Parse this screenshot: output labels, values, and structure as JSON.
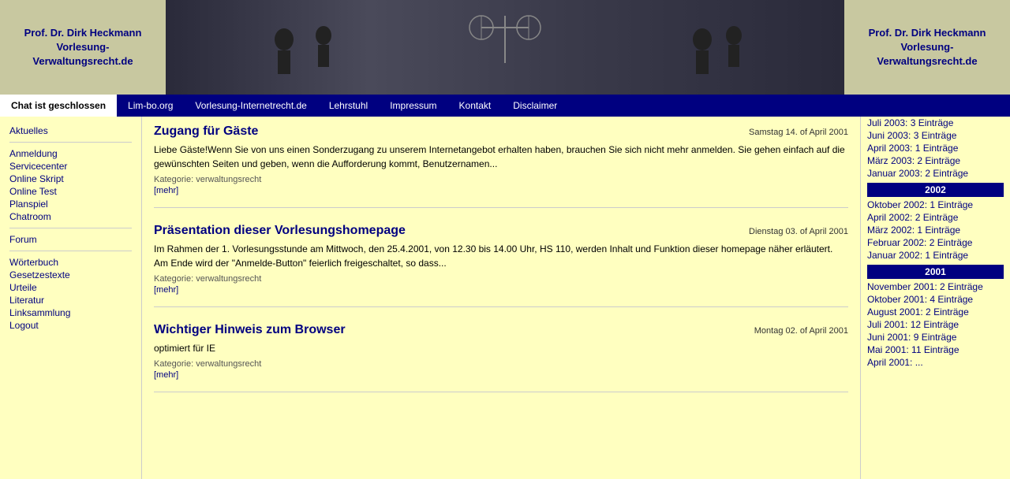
{
  "header": {
    "left_title": "Prof. Dr. Dirk Heckmann\nVorlesung-\nVerwaltungsrecht.de",
    "right_title": "Prof. Dr. Dirk Heckmann\nVorlesung-\nVerwaltungsrecht.de"
  },
  "navbar": {
    "items": [
      {
        "label": "Chat ist geschlossen",
        "active": true
      },
      {
        "label": "Lim-bo.org",
        "active": false
      },
      {
        "label": "Vorlesung-Internetrecht.de",
        "active": false
      },
      {
        "label": "Lehrstuhl",
        "active": false
      },
      {
        "label": "Impressum",
        "active": false
      },
      {
        "label": "Kontakt",
        "active": false
      },
      {
        "label": "Disclaimer",
        "active": false
      }
    ]
  },
  "sidebar": {
    "sections": [
      {
        "title": "Aktuelles",
        "links": []
      },
      {
        "title": "",
        "links": [
          "Anmeldung",
          "Servicecenter",
          "Online Skript",
          "Online Test",
          "Planspiel",
          "Chatroom"
        ]
      },
      {
        "title": "Forum",
        "links": []
      },
      {
        "title": "",
        "links": [
          "Wörterbuch",
          "Gesetzestexte",
          "Urteile",
          "Literatur",
          "Linksammlung",
          "Logout"
        ]
      }
    ]
  },
  "articles": [
    {
      "title": "Zugang für Gäste",
      "date": "Samstag 14. of April 2001",
      "body": "Liebe Gäste!Wenn Sie von uns einen Sonderzugang zu unserem Internetangebot erhalten haben, brauchen Sie sich nicht mehr anmelden. Sie gehen einfach auf die gewünschten Seiten und geben, wenn die Aufforderung kommt, Benutzernamen...",
      "category": "Kategorie: verwaltungsrecht",
      "more": "[mehr]"
    },
    {
      "title": "Präsentation dieser Vorlesungshomepage",
      "date": "Dienstag 03. of April 2001",
      "body": "Im Rahmen der 1. Vorlesungsstunde am Mittwoch, den 25.4.2001, von 12.30 bis 14.00 Uhr, HS 110, werden Inhalt und Funktion dieser homepage näher erläutert. Am Ende wird der \"Anmelde-Button\" feierlich freigeschaltet, so dass...",
      "category": "Kategorie: verwaltungsrecht",
      "more": "[mehr]"
    },
    {
      "title": "Wichtiger Hinweis zum Browser",
      "date": "Montag 02. of April 2001",
      "body": "optimiert für IE",
      "category": "Kategorie: verwaltungsrecht",
      "more": "[mehr]"
    }
  ],
  "right_sidebar": {
    "sections": [
      {
        "year": "",
        "entries": [
          "Juli 2003: 3 Einträge",
          "Juni 2003: 3 Einträge",
          "April 2003: 1 Einträge",
          "März 2003: 2 Einträge",
          "Januar 2003: 2 Einträge"
        ]
      },
      {
        "year": "2002",
        "entries": [
          "Oktober 2002: 1 Einträge",
          "April 2002: 2 Einträge",
          "März 2002: 1 Einträge",
          "Februar 2002: 2 Einträge",
          "Januar 2002: 1 Einträge"
        ]
      },
      {
        "year": "2001",
        "entries": [
          "November 2001: 2 Einträge",
          "Oktober 2001: 4 Einträge",
          "August 2001: 2 Einträge",
          "Juli 2001: 12 Einträge",
          "Juni 2001: 9 Einträge",
          "Mai 2001: 11 Einträge",
          "April 2001: ..."
        ]
      }
    ]
  }
}
